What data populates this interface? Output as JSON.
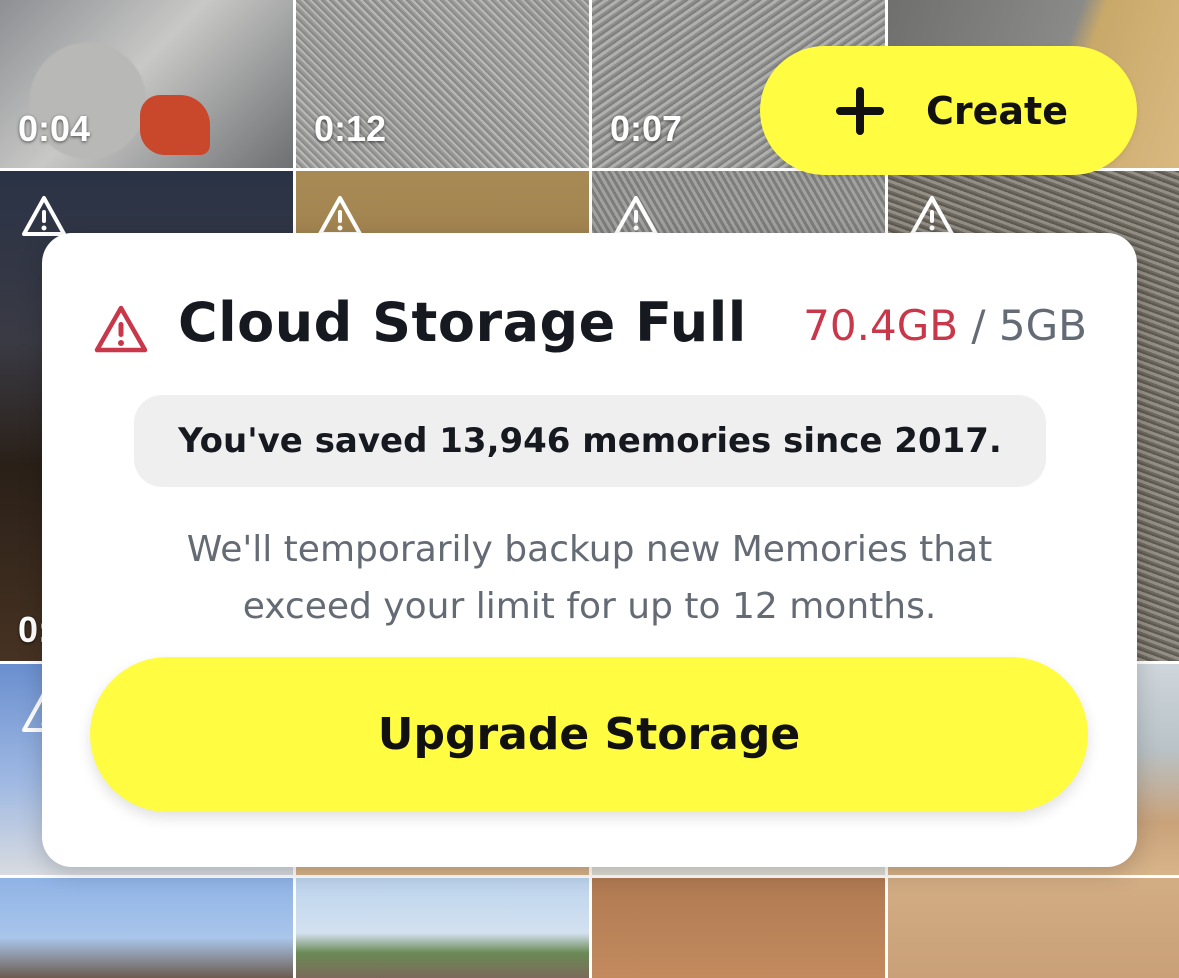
{
  "grid": {
    "durations": [
      "0:04",
      "0:12",
      "0:07"
    ],
    "partial_duration": "0:"
  },
  "create_button": {
    "label": "Create"
  },
  "storage_dialog": {
    "title": "Cloud Storage Full",
    "usage_used": "70.4GB",
    "usage_separator": " / ",
    "usage_limit": "5GB",
    "summary": "You've saved 13,946 memories since 2017.",
    "description_line1": "We'll temporarily backup new Memories that",
    "description_line2": "exceed your limit for up to 12 months.",
    "upgrade_label": "Upgrade Storage"
  },
  "colors": {
    "accent_yellow": "#fffc41",
    "alert_red": "#c8374a",
    "muted_text": "#646b75"
  }
}
